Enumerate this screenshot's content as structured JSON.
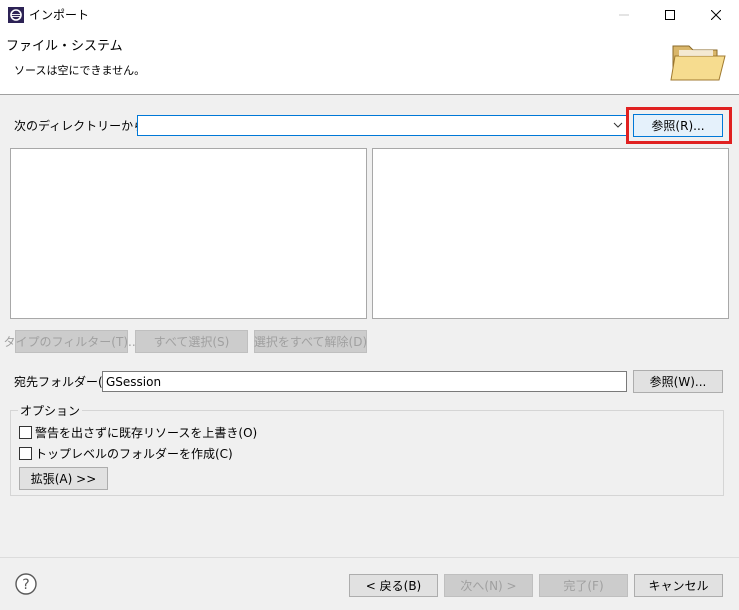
{
  "window": {
    "title": "インポート"
  },
  "header": {
    "title": "ファイル・システム",
    "message": "ソースは空にできません。"
  },
  "source": {
    "label": "次のディレクトリーから(Y):",
    "value": "",
    "browse_label": "参照(R)..."
  },
  "filters": {
    "type_filter_label": "タイプのフィルター(T)...",
    "select_all_label": "すべて選択(S)",
    "deselect_all_label": "選択をすべて解除(D)"
  },
  "destination": {
    "label": "宛先フォルダー(L):",
    "value": "GSession",
    "browse_label": "参照(W)..."
  },
  "options": {
    "title": "オプション",
    "overwrite_label": "警告を出さずに既存リソースを上書き(O)",
    "overwrite_checked": false,
    "create_top_level_label": "トップレベルのフォルダーを作成(C)",
    "create_top_level_checked": false,
    "advanced_label": "拡張(A) >>"
  },
  "footer": {
    "back_label": "< 戻る(B)",
    "next_label": "次へ(N) >",
    "finish_label": "完了(F)",
    "cancel_label": "キャンセル"
  },
  "colors": {
    "highlight": "#e02020",
    "focus": "#0078d7"
  }
}
